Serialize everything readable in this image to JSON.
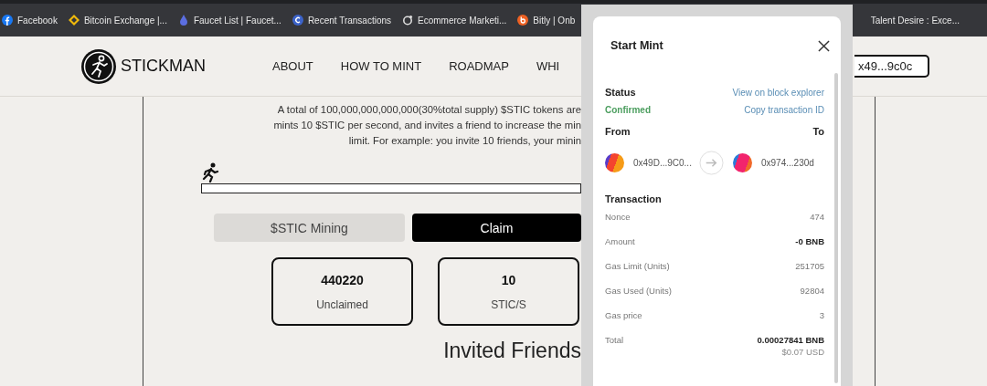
{
  "bookmarks": [
    {
      "label": "Facebook"
    },
    {
      "label": "Bitcoin Exchange |..."
    },
    {
      "label": "Faucet List | Faucet..."
    },
    {
      "label": "Recent Transactions"
    },
    {
      "label": "Ecommerce Marketi..."
    },
    {
      "label": "Bitly | Onb"
    },
    {
      "label": "Talent Desire : Exce..."
    }
  ],
  "header": {
    "logo": "STICKMAN",
    "nav": [
      "ABOUT",
      "HOW TO MINT",
      "ROADMAP",
      "WHI"
    ],
    "wallet": "x49...9c0c"
  },
  "description": [
    "A total of 100,000,000,000,000(30%total supply) $STIC tokens are",
    "mints 10 $STIC per second, and invites a friend to increase the min",
    "limit. For example: you invite 10 friends, your minin"
  ],
  "progress": {
    "level": 0
  },
  "tabs": [
    {
      "label": "$STIC Mining",
      "selected": false
    },
    {
      "label": "Claim",
      "selected": true
    }
  ],
  "stats": [
    {
      "value": "440220",
      "label": "Unclaimed"
    },
    {
      "value": "10",
      "label": "STIC/S"
    }
  ],
  "invited_title": "Invited Friends",
  "modal": {
    "title": "Start Mint",
    "status_label": "Status",
    "status": "Confirmed",
    "explorer_link": "View on block explorer",
    "copy_link": "Copy transaction ID",
    "from_label": "From",
    "to_label": "To",
    "from": "0x49D...9C0...",
    "to": "0x974...230d",
    "section": "Transaction",
    "rows": [
      {
        "label": "Nonce",
        "value": "474",
        "bold": false
      },
      {
        "label": "Amount",
        "value": "-0 BNB",
        "bold": true
      },
      {
        "label": "Gas Limit (Units)",
        "value": "251705",
        "bold": false
      },
      {
        "label": "Gas Used (Units)",
        "value": "92804",
        "bold": false
      },
      {
        "label": "Gas price",
        "value": "3",
        "bold": false
      },
      {
        "label": "Total",
        "value": "0.00027841 BNB",
        "bold": true,
        "sub": "$0.07 USD"
      }
    ]
  }
}
